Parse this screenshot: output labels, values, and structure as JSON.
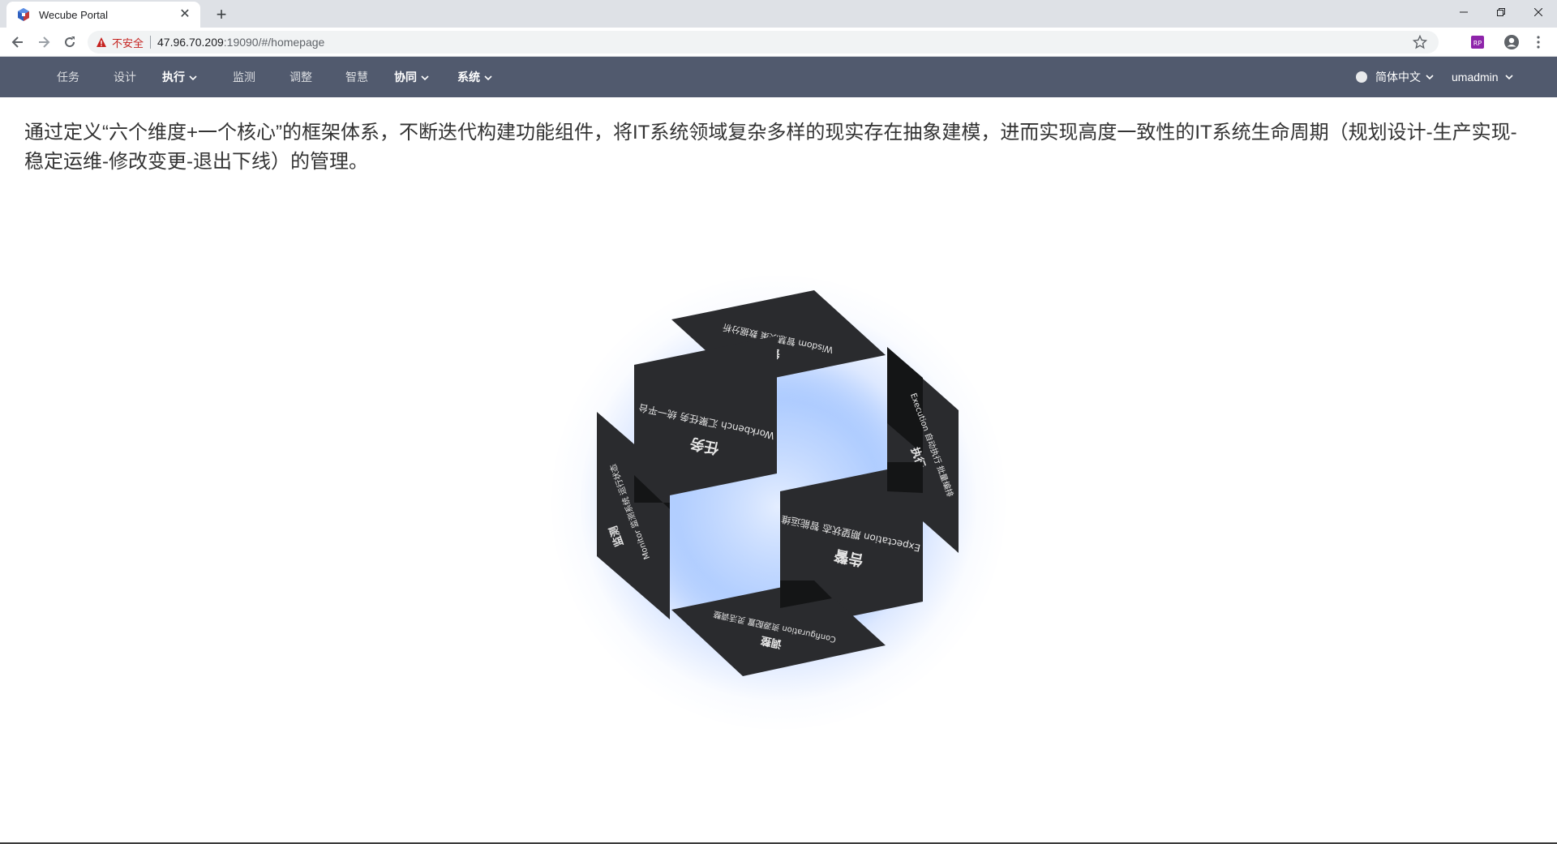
{
  "browser": {
    "tab_title": "Wecube Portal",
    "new_tab_glyph": "+",
    "insecure_label": "不安全",
    "url_host": "47.96.70.209",
    "url_path": ":19090/#/homepage"
  },
  "nav": {
    "items": [
      {
        "label": "任务",
        "bold": false,
        "dropdown": false
      },
      {
        "label": "设计",
        "bold": false,
        "dropdown": false
      },
      {
        "label": "执行",
        "bold": true,
        "dropdown": true
      },
      {
        "label": "监测",
        "bold": false,
        "dropdown": false
      },
      {
        "label": "调整",
        "bold": false,
        "dropdown": false
      },
      {
        "label": "智慧",
        "bold": false,
        "dropdown": false
      },
      {
        "label": "协同",
        "bold": true,
        "dropdown": true
      },
      {
        "label": "系统",
        "bold": true,
        "dropdown": true
      }
    ],
    "language": "简体中文",
    "user": "umadmin"
  },
  "content": {
    "intro": "通过定义“六个维度+一个核心”的框架体系，不断迭代构建功能组件，将IT系统领域复杂多样的现实存在抽象建模，进而实现高度一致性的IT系统生命周期（规划设计-生产实现-稳定运维-修改变更-退出下线）的管理。"
  },
  "cube": {
    "glow_color": "#5a96ff",
    "panels": [
      {
        "title": "任务",
        "subtitle": "Workbench 汇聚任务 统一平台"
      },
      {
        "title": "执行",
        "subtitle": "Execution 自动执行 批量编排"
      },
      {
        "title": "监测",
        "subtitle": "Monitor 监测系统 运行状态"
      },
      {
        "title": "告警",
        "subtitle": "Expectation 期望状态 智能运维"
      },
      {
        "title": "调整",
        "subtitle": "Configuration 资源配置 灵活调整"
      },
      {
        "title": "智慧",
        "subtitle": "Wisdom 智慧决策 数据分析"
      }
    ]
  },
  "colors": {
    "nav_bg": "#515a6e",
    "panel_fill": "#2a2b2e",
    "insecure": "#c5221f"
  }
}
